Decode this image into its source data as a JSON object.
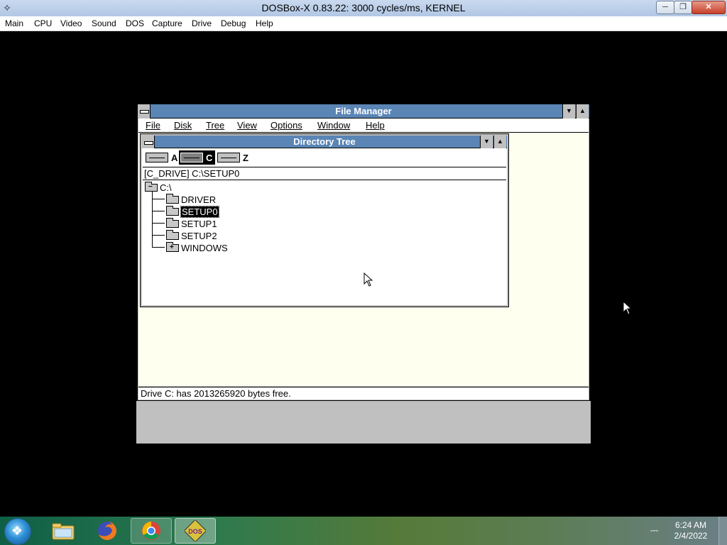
{
  "host": {
    "title": "DOSBox-X 0.83.22: 3000 cycles/ms, KERNEL",
    "icon": "dosbox-icon",
    "menu": [
      "Main",
      "CPU",
      "Video",
      "Sound",
      "DOS",
      "Capture",
      "Drive",
      "Debug",
      "Help"
    ]
  },
  "file_manager": {
    "title": "File Manager",
    "menu": [
      "File",
      "Disk",
      "Tree",
      "View",
      "Options",
      "Window",
      "Help"
    ],
    "status": "Drive C: has 2013265920 bytes free."
  },
  "directory_tree": {
    "title": "Directory Tree",
    "drives": [
      {
        "letter": "A",
        "type": "floppy"
      },
      {
        "letter": "C",
        "type": "hard-disk",
        "selected": true
      },
      {
        "letter": "Z",
        "type": "hard-disk"
      }
    ],
    "path": "[C_DRIVE]  C:\\SETUP0",
    "root": "C:\\",
    "folders": [
      {
        "name": "DRIVER",
        "selected": false,
        "expandable": false
      },
      {
        "name": "SETUP0",
        "selected": true,
        "expandable": false
      },
      {
        "name": "SETUP1",
        "selected": false,
        "expandable": false
      },
      {
        "name": "SETUP2",
        "selected": false,
        "expandable": false
      },
      {
        "name": "WINDOWS",
        "selected": false,
        "expandable": true
      }
    ]
  },
  "taskbar": {
    "apps": [
      "windows-explorer",
      "firefox",
      "chrome",
      "dosbox-x"
    ],
    "active_app": "dosbox-x",
    "time": "6:24 AM",
    "date": "2/4/2022"
  },
  "colors": {
    "win31_titlebar": "#5a85b5",
    "win31_face": "#c0c0c0",
    "workspace": "#fffff0"
  }
}
